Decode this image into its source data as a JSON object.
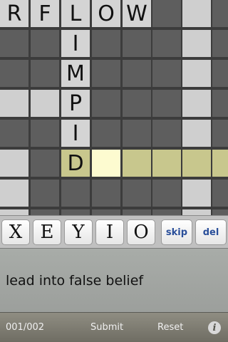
{
  "board": {
    "rows": [
      [
        "R",
        "F",
        "L",
        "O",
        "W",
        "",
        "",
        ""
      ],
      [
        "",
        "",
        "I",
        "",
        "",
        "",
        "",
        ""
      ],
      [
        "",
        "",
        "M",
        "",
        "",
        "",
        "",
        ""
      ],
      [
        "",
        "",
        "P",
        "",
        "",
        "",
        "",
        ""
      ],
      [
        "",
        "",
        "I",
        "",
        "",
        "",
        "",
        ""
      ],
      [
        "",
        "",
        "D",
        "",
        "",
        "",
        "",
        ""
      ],
      [
        "",
        "",
        "",
        "",
        "",
        "",
        "",
        ""
      ],
      [
        "",
        "",
        "",
        "",
        "",
        "",
        "",
        ""
      ]
    ],
    "shades": [
      [
        "ltr-light",
        "ltr-light",
        "ltr-light",
        "ltr-light",
        "ltr-light",
        "dark",
        "light",
        "dark"
      ],
      [
        "dark",
        "dark",
        "ltr-light",
        "dark",
        "dark",
        "dark",
        "light",
        "dark"
      ],
      [
        "dark",
        "dark",
        "ltr-light",
        "dark",
        "dark",
        "dark",
        "light",
        "dark"
      ],
      [
        "light",
        "light",
        "ltr-light",
        "dark",
        "dark",
        "dark",
        "light",
        "dark"
      ],
      [
        "dark",
        "dark",
        "ltr-light",
        "dark",
        "dark",
        "dark",
        "light",
        "dark"
      ],
      [
        "light",
        "dark",
        "ltr-yellow",
        "cursor",
        "yellow",
        "yellow",
        "yellow",
        "yellow"
      ],
      [
        "light",
        "dark",
        "dark",
        "dark",
        "dark",
        "dark",
        "light",
        "dark"
      ],
      [
        "light",
        "dark",
        "dark",
        "dark",
        "dark",
        "dark",
        "light",
        "dark"
      ]
    ]
  },
  "keyboard": {
    "letters": [
      "X",
      "E",
      "Y",
      "I",
      "O"
    ],
    "skip_label": "skip",
    "del_label": "del"
  },
  "clue": {
    "text": "lead into false belief"
  },
  "footer": {
    "progress": "001/002",
    "submit_label": "Submit",
    "reset_label": "Reset",
    "info_glyph": "i"
  }
}
